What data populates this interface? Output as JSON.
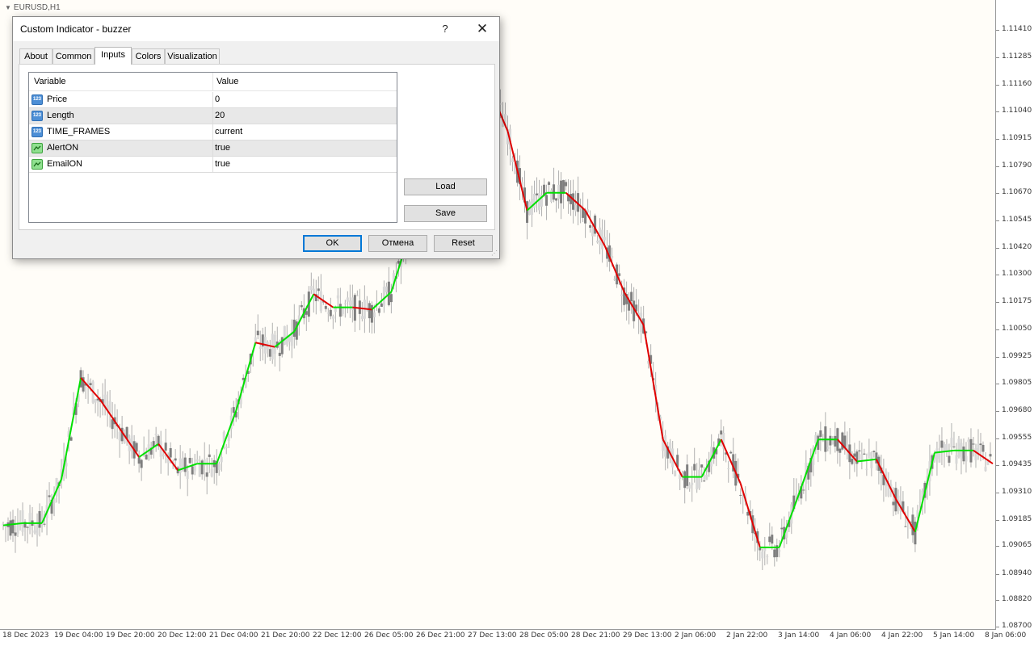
{
  "chart": {
    "symbol_label": "EURUSD,H1",
    "price_axis": [
      "1.11410",
      "1.11285",
      "1.11160",
      "1.11040",
      "1.10915",
      "1.10790",
      "1.10670",
      "1.10545",
      "1.10420",
      "1.10300",
      "1.10175",
      "1.10050",
      "1.09925",
      "1.09805",
      "1.09680",
      "1.09555",
      "1.09435",
      "1.09310",
      "1.09185",
      "1.09065",
      "1.08940",
      "1.08820",
      "1.08700"
    ],
    "time_axis": [
      "18 Dec 2023",
      "19 Dec 04:00",
      "19 Dec 20:00",
      "20 Dec 12:00",
      "21 Dec 04:00",
      "21 Dec 20:00",
      "22 Dec 12:00",
      "26 Dec 05:00",
      "26 Dec 21:00",
      "27 Dec 13:00",
      "28 Dec 05:00",
      "28 Dec 21:00",
      "29 Dec 13:00",
      "2 Jan 06:00",
      "2 Jan 22:00",
      "3 Jan 14:00",
      "4 Jan 06:00",
      "4 Jan 22:00",
      "5 Jan 14:00",
      "8 Jan 06:00"
    ],
    "colors": {
      "up_line": "#00e000",
      "down_line": "#e00000",
      "candle": "#7f7f7f",
      "background": "#fffdf8"
    }
  },
  "chart_data": {
    "type": "line",
    "x_labels": [
      "18 Dec 2023",
      "19 Dec 04:00",
      "19 Dec 20:00",
      "20 Dec 12:00",
      "21 Dec 04:00",
      "21 Dec 20:00",
      "22 Dec 12:00",
      "26 Dec 05:00",
      "26 Dec 21:00",
      "27 Dec 13:00",
      "28 Dec 05:00",
      "28 Dec 21:00",
      "29 Dec 13:00",
      "2 Jan 06:00",
      "2 Jan 22:00",
      "3 Jan 14:00",
      "4 Jan 06:00",
      "4 Jan 22:00",
      "5 Jan 14:00",
      "8 Jan 06:00"
    ],
    "ylim": [
      1.087,
      1.1141
    ],
    "series": [
      {
        "values": [
          1.0916,
          1.0917,
          1.0917,
          1.0937,
          1.0983,
          1.0973,
          1.096,
          1.0947,
          1.0953,
          1.0941,
          1.0944,
          1.0944,
          1.0968,
          1.0999,
          1.0997,
          1.1004,
          1.1021,
          1.1015,
          1.1015,
          1.1014,
          1.1022,
          1.105,
          1.1082,
          1.1096,
          1.1116,
          1.1116,
          1.1095,
          1.1059,
          1.1067,
          1.1067,
          1.1059,
          1.1043,
          1.1022,
          1.1007,
          1.0955,
          1.0938,
          1.0938,
          1.0955,
          1.0935,
          1.0906,
          1.0906,
          1.093,
          1.0955,
          1.0955,
          1.0945,
          1.0946,
          1.0928,
          1.0913,
          1.0949,
          1.095,
          1.095,
          1.0944
        ]
      }
    ]
  },
  "dialog": {
    "title": "Custom Indicator - buzzer",
    "help_glyph": "?",
    "close_glyph": "✕",
    "tabs": [
      "About",
      "Common",
      "Inputs",
      "Colors",
      "Visualization"
    ],
    "active_tab": "Inputs",
    "grid_headers": {
      "variable": "Variable",
      "value": "Value"
    },
    "params": [
      {
        "name": "Price",
        "value": "0",
        "kind": "number",
        "icon_text": "123"
      },
      {
        "name": "Length",
        "value": "20",
        "kind": "number",
        "icon_text": "123"
      },
      {
        "name": "TIME_FRAMES",
        "value": "current",
        "kind": "number",
        "icon_text": "123"
      },
      {
        "name": "AlertON",
        "value": "true",
        "kind": "bool",
        "icon_text": ""
      },
      {
        "name": "EmailON",
        "value": "true",
        "kind": "bool",
        "icon_text": ""
      }
    ],
    "buttons": {
      "load": "Load",
      "save": "Save",
      "ok": "OK",
      "cancel": "Отмена",
      "reset": "Reset"
    }
  }
}
